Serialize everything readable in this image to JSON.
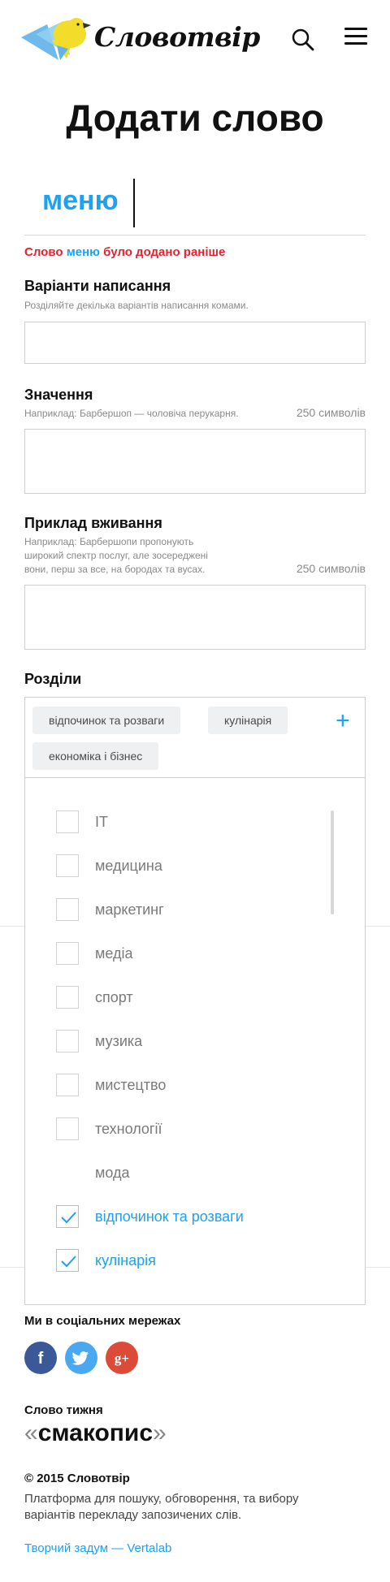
{
  "header": {
    "logo_text": "Словотвір",
    "search_icon": "search-icon",
    "menu_icon": "hamburger-menu-icon"
  },
  "page": {
    "title": "Додати слово"
  },
  "word": {
    "value": "меню",
    "warning_prefix": "Слово",
    "warning_word": "меню",
    "warning_suffix": "було додано раніше"
  },
  "spellings": {
    "label": "Варіанти написання",
    "hint": "Розділяйте декілька варіантів написання комами.",
    "value": ""
  },
  "meaning": {
    "label": "Значення",
    "hint": "Наприклад: Барбершоп — чоловіча перукарня.",
    "counter": "250 символів",
    "value": ""
  },
  "example": {
    "label": "Приклад вживання",
    "hint_lines": [
      "Наприклад: Барбершопи пропонують",
      "широкий спектр послуг, але зосереджені",
      "вони, перш за все, на бородах та вусах."
    ],
    "counter": "250 символів",
    "value": ""
  },
  "sections": {
    "label": "Розділи",
    "selected": [
      "відпочинок та розваги",
      "кулінарія",
      "економіка і бізнес"
    ],
    "add_icon": "plus-icon",
    "options": [
      {
        "label": "IT",
        "checked": false,
        "has_box": true
      },
      {
        "label": "медицина",
        "checked": false,
        "has_box": true
      },
      {
        "label": "маркетинг",
        "checked": false,
        "has_box": true
      },
      {
        "label": "медіа",
        "checked": false,
        "has_box": true
      },
      {
        "label": "спорт",
        "checked": false,
        "has_box": true
      },
      {
        "label": "музика",
        "checked": false,
        "has_box": true
      },
      {
        "label": "мистецтво",
        "checked": false,
        "has_box": true
      },
      {
        "label": "технології",
        "checked": false,
        "has_box": true
      },
      {
        "label": "мода",
        "checked": false,
        "has_box": false
      },
      {
        "label": "відпочинок та розваги",
        "checked": true,
        "has_box": true
      },
      {
        "label": "кулінарія",
        "checked": true,
        "has_box": true
      }
    ]
  },
  "footer": {
    "social_label": "Ми в соціальних мережах",
    "social": [
      {
        "name": "facebook-icon",
        "glyph": "f",
        "color": "#3b5998"
      },
      {
        "name": "twitter-icon",
        "glyph": "",
        "color": "#4aa8f0"
      },
      {
        "name": "google-plus-icon",
        "glyph": "g+",
        "color": "#dc4a38"
      }
    ],
    "word_of_week_label": "Слово тижня",
    "word_of_week": "смакопис",
    "copyright": "© 2015 Словотвір",
    "description": "Платформа для пошуку, обговорення, та вибору варіантів перекладу запозичених слів.",
    "credit": "Творчий задум — Vertalab"
  },
  "colors": {
    "accent": "#1da1f2",
    "warning": "#e8212f",
    "logo_blue": "#5fb3e8",
    "logo_yellow": "#f4dc2b"
  }
}
